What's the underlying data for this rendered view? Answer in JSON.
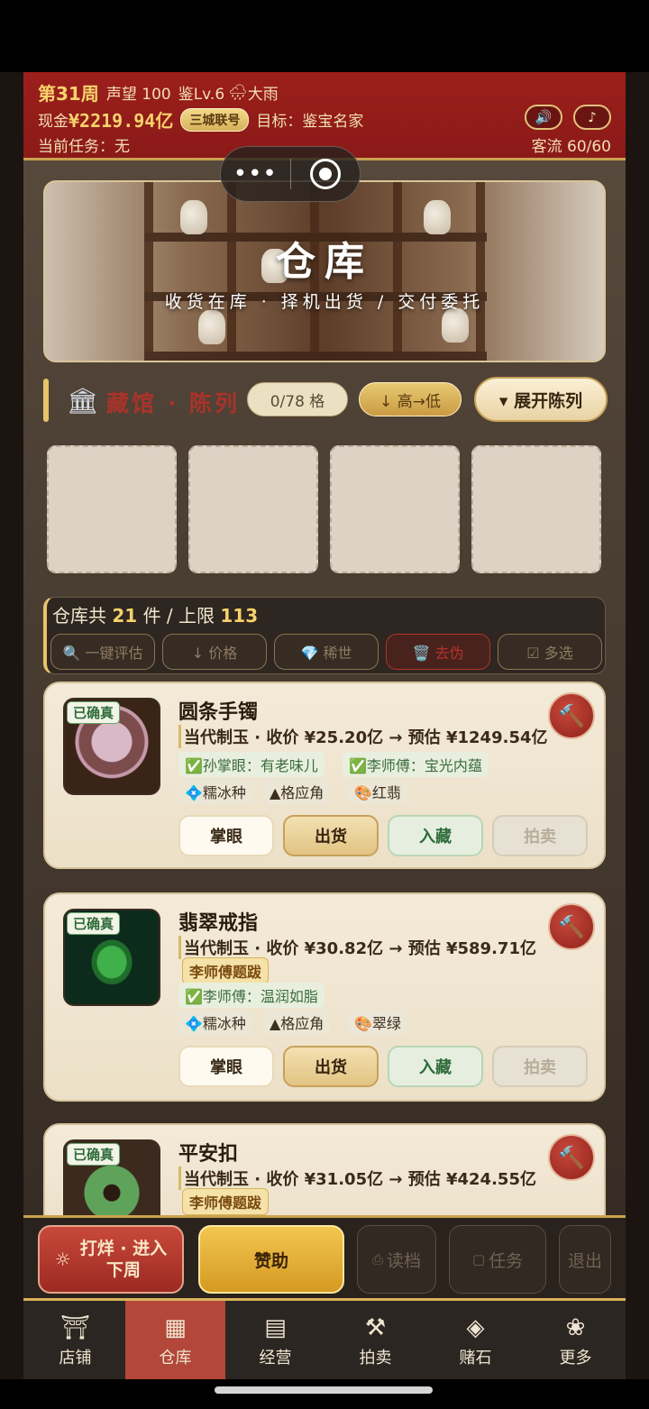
{
  "header": {
    "week": "第31周",
    "reputation": "声望 100",
    "level": "鉴Lv.6",
    "weather_icon": "rain-cloud-icon",
    "weather": "大雨",
    "cash_label": "现金",
    "cash_value": "¥2219.94亿",
    "badge": "三城联号",
    "goal": "目标：鉴宝名家",
    "task": "当前任务：无",
    "traffic": "客流 60/60",
    "sound_icon": "speaker-icon",
    "music_icon": "music-note-icon"
  },
  "capsule": {
    "more": "•••"
  },
  "banner": {
    "title": "仓库",
    "subtitle": "收货在库 · 择机出货 / 交付委托"
  },
  "museum": {
    "title": "藏馆 · 陈列",
    "count": "0/78 格",
    "sort": "↓ 高→低",
    "expand": "▾ 展开陈列"
  },
  "warehouse": {
    "count_prefix": "仓库共",
    "count": "21",
    "count_mid": "件 / 上限",
    "limit": "113",
    "buttons": [
      "🔍 一键评估",
      "↓ 价格",
      "💎 稀世",
      "🗑️ 去伪",
      "☑ 多选"
    ]
  },
  "items": [
    {
      "verified": "已确真",
      "name": "圆条手镯",
      "price": "当代制玉 · 收价 ¥25.20亿 → 预估 ¥1249.54亿",
      "notes": [
        "✅孙掌眼：有老味儿",
        "✅李师傅：宝光内蕴"
      ],
      "tags": [
        "💠糯冰种",
        "▲格应角",
        "🎨红翡"
      ],
      "actions": [
        "掌眼",
        "出货",
        "入藏",
        "拍卖"
      ]
    },
    {
      "verified": "已确真",
      "name": "翡翠戒指",
      "price": "当代制玉 · 收价 ¥30.82亿 → 预估 ¥589.71亿",
      "inscription": "李师傅题跋",
      "notes": [
        "✅李师傅：温润如脂"
      ],
      "tags": [
        "💠糯冰种",
        "▲格应角",
        "🎨翠绿"
      ],
      "actions": [
        "掌眼",
        "出货",
        "入藏",
        "拍卖"
      ]
    },
    {
      "verified": "已确真",
      "name": "平安扣",
      "price": "当代制玉 · 收价 ¥31.05亿 → 预估 ¥424.55亿",
      "inscription": "李师傅题跋"
    }
  ],
  "actionbar": {
    "forge_line1": "打烊 · 进入",
    "forge_line2": "下周",
    "sponsor": "赞助",
    "load": "读档",
    "tasks": "任务",
    "exit": "退出"
  },
  "nav": [
    {
      "label": "店铺",
      "icon": "shop-icon"
    },
    {
      "label": "仓库",
      "icon": "warehouse-icon"
    },
    {
      "label": "经营",
      "icon": "abacus-icon"
    },
    {
      "label": "拍卖",
      "icon": "gavel-icon"
    },
    {
      "label": "赌石",
      "icon": "jade-stone-icon"
    },
    {
      "label": "更多",
      "icon": "gourd-icon"
    }
  ],
  "colors": {
    "header_red": "#8a1a18",
    "gold": "#f7d36b",
    "active_tab": "#b2473a"
  }
}
